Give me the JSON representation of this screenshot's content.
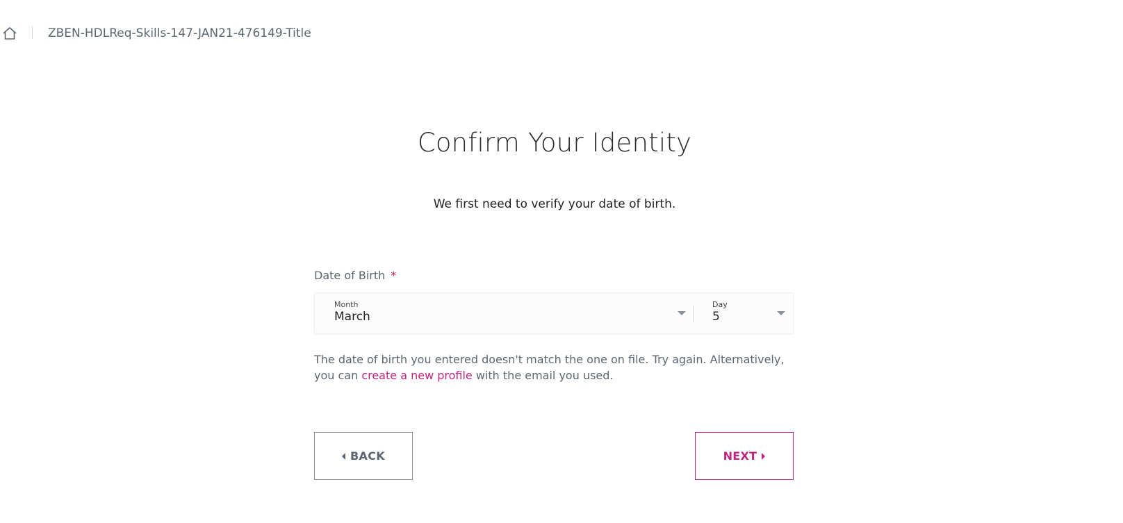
{
  "header": {
    "home_icon": "home-icon",
    "page_name": "ZBEN-HDLReq-Skills-147-JAN21-476149-Title"
  },
  "main": {
    "title": "Confirm Your Identity",
    "subtitle": "We first need to verify your date of birth.",
    "dob": {
      "label": "Date of Birth",
      "required_marker": "*",
      "month": {
        "label": "Month",
        "value": "March"
      },
      "day": {
        "label": "Day",
        "value": "5"
      }
    },
    "error": {
      "text_before": "The date of birth you entered doesn't match the one on file. Try again. Alternatively, you can ",
      "link": "create a new profile",
      "text_after": " with the email you used."
    },
    "buttons": {
      "back": "BACK",
      "next": "NEXT"
    }
  },
  "colors": {
    "accent": "#c0247f",
    "required": "#c8214b",
    "muted_text": "#5b6670"
  }
}
